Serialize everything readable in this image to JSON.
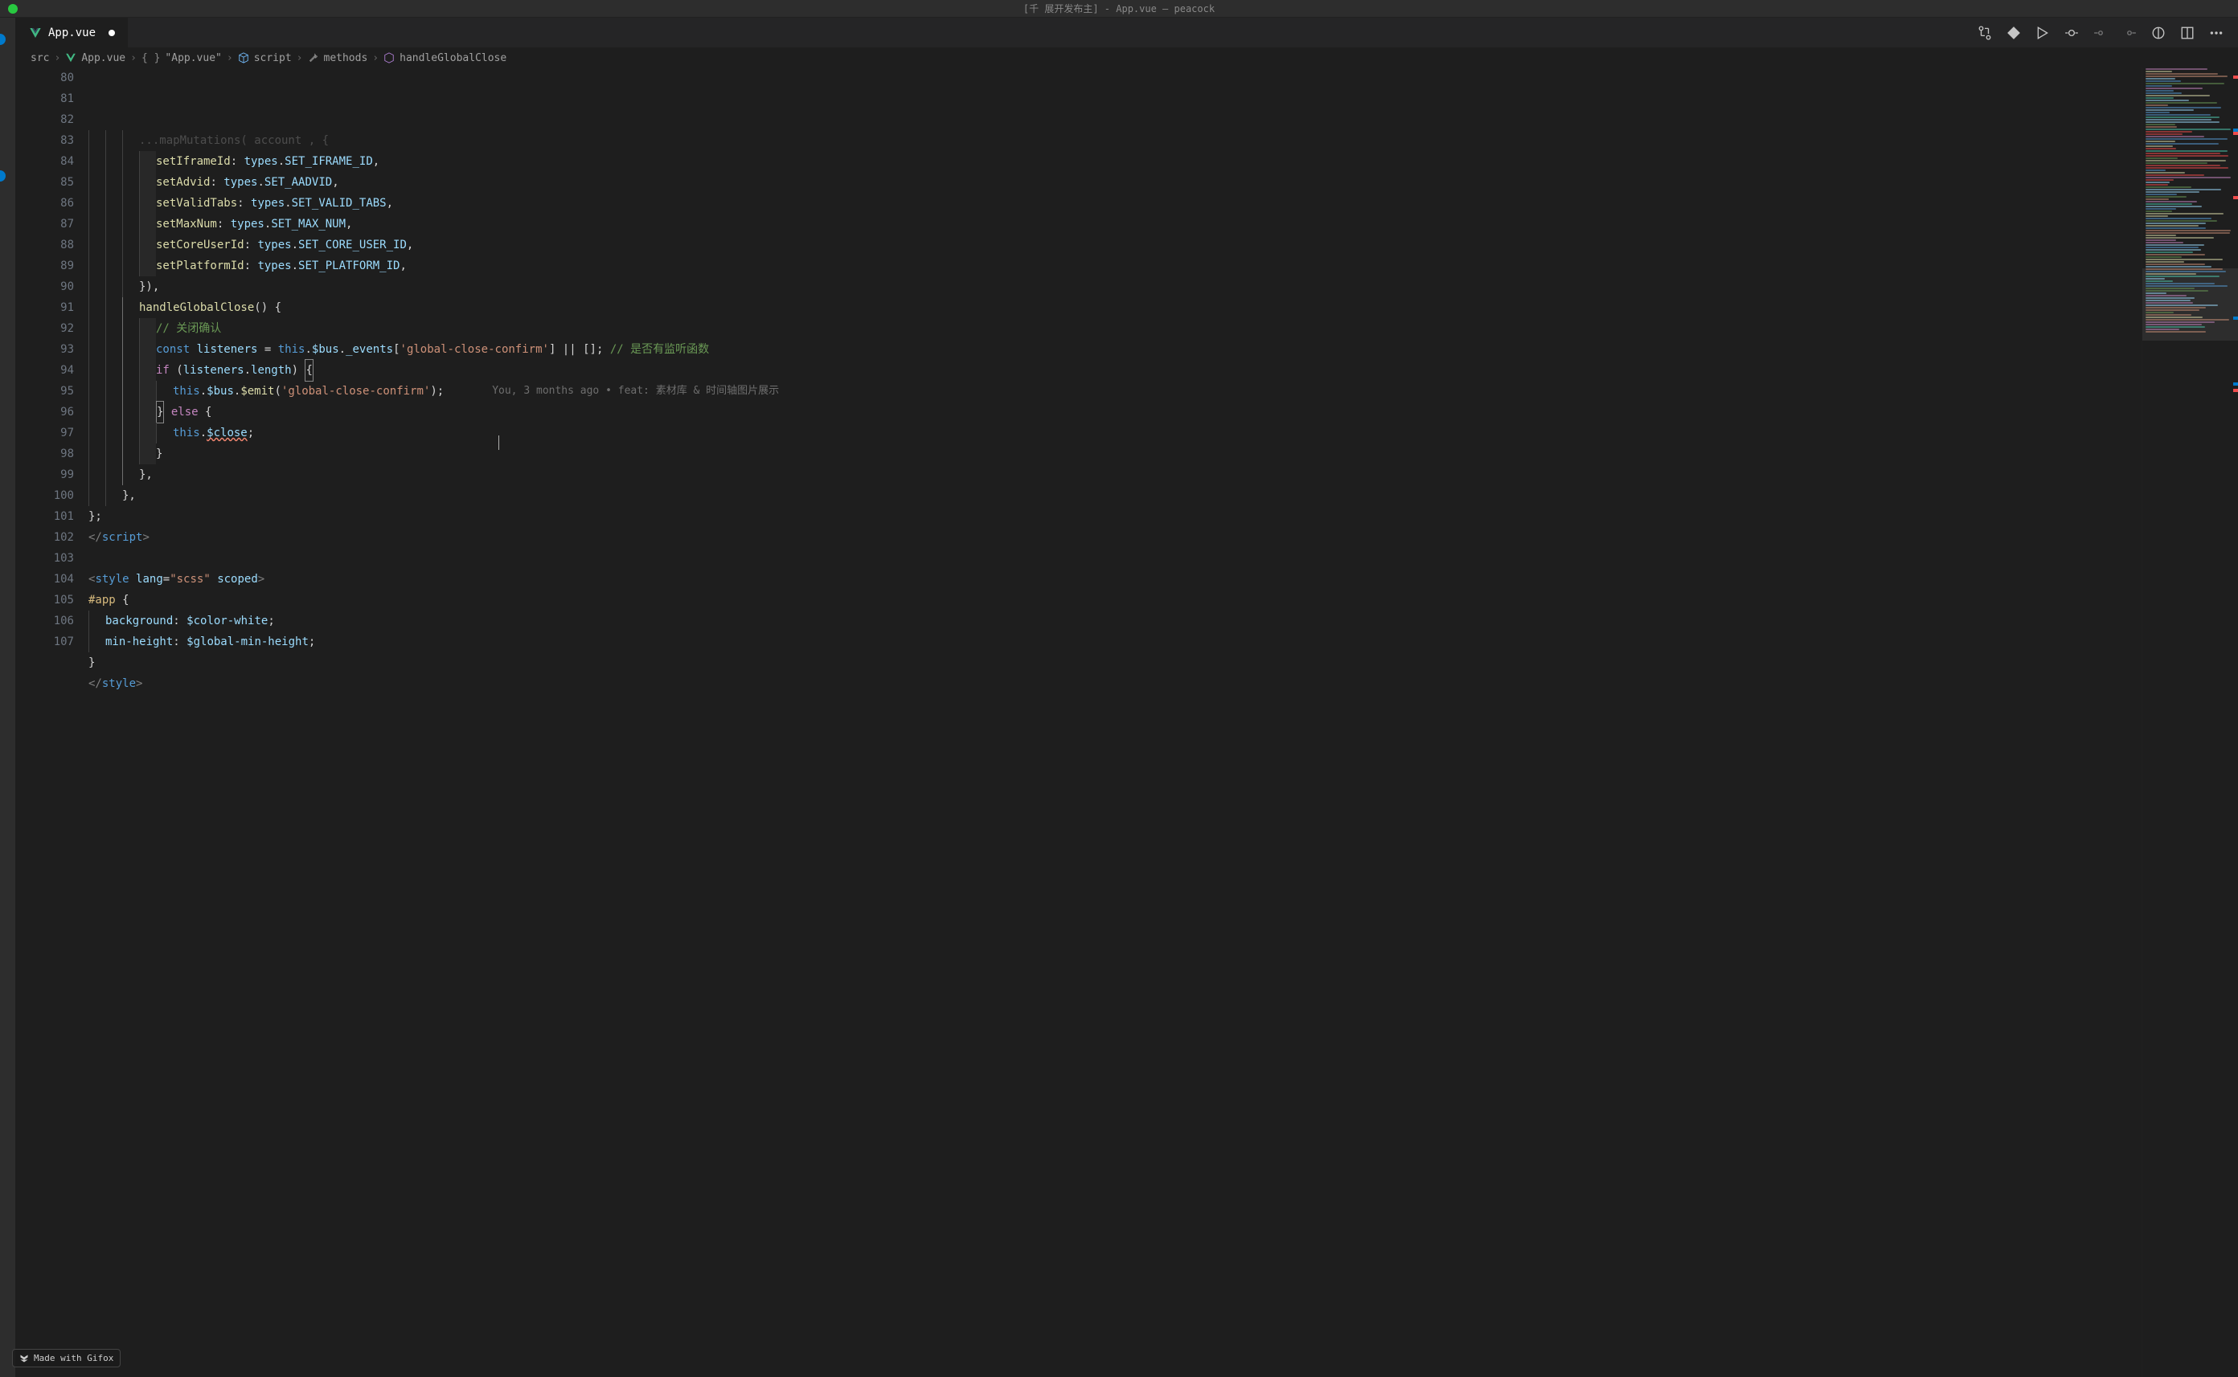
{
  "titlebar": {
    "text": "[千 展开发布主] - App.vue — peacock"
  },
  "tab": {
    "filename": "App.vue"
  },
  "breadcrumb": {
    "parts": [
      "src",
      "App.vue",
      "\"App.vue\"",
      "script",
      "methods",
      "handleGlobalClose"
    ]
  },
  "gutter": {
    "start": 80,
    "end": 107
  },
  "code": {
    "lines": [
      {
        "n": 80,
        "indent": 3,
        "tokens": [
          {
            "t": "...mapMutations( account , {",
            "c": "tok-punct",
            "faded": true
          }
        ]
      },
      {
        "n": 81,
        "indent": 4,
        "tokens": [
          {
            "t": "setIframeId",
            "c": "tok-func"
          },
          {
            "t": ": ",
            "c": "tok-punct"
          },
          {
            "t": "types",
            "c": "tok-prop"
          },
          {
            "t": ".",
            "c": "tok-punct"
          },
          {
            "t": "SET_IFRAME_ID",
            "c": "tok-prop"
          },
          {
            "t": ",",
            "c": "tok-punct"
          }
        ]
      },
      {
        "n": 82,
        "indent": 4,
        "tokens": [
          {
            "t": "setAdvid",
            "c": "tok-func"
          },
          {
            "t": ": ",
            "c": "tok-punct"
          },
          {
            "t": "types",
            "c": "tok-prop"
          },
          {
            "t": ".",
            "c": "tok-punct"
          },
          {
            "t": "SET_AADVID",
            "c": "tok-prop"
          },
          {
            "t": ",",
            "c": "tok-punct"
          }
        ]
      },
      {
        "n": 83,
        "indent": 4,
        "tokens": [
          {
            "t": "setValidTabs",
            "c": "tok-func"
          },
          {
            "t": ": ",
            "c": "tok-punct"
          },
          {
            "t": "types",
            "c": "tok-prop"
          },
          {
            "t": ".",
            "c": "tok-punct"
          },
          {
            "t": "SET_VALID_TABS",
            "c": "tok-prop"
          },
          {
            "t": ",",
            "c": "tok-punct"
          }
        ]
      },
      {
        "n": 84,
        "indent": 4,
        "tokens": [
          {
            "t": "setMaxNum",
            "c": "tok-func"
          },
          {
            "t": ": ",
            "c": "tok-punct"
          },
          {
            "t": "types",
            "c": "tok-prop"
          },
          {
            "t": ".",
            "c": "tok-punct"
          },
          {
            "t": "SET_MAX_NUM",
            "c": "tok-prop"
          },
          {
            "t": ",",
            "c": "tok-punct"
          }
        ]
      },
      {
        "n": 85,
        "indent": 4,
        "tokens": [
          {
            "t": "setCoreUserId",
            "c": "tok-func"
          },
          {
            "t": ": ",
            "c": "tok-punct"
          },
          {
            "t": "types",
            "c": "tok-prop"
          },
          {
            "t": ".",
            "c": "tok-punct"
          },
          {
            "t": "SET_CORE_USER_ID",
            "c": "tok-prop"
          },
          {
            "t": ",",
            "c": "tok-punct"
          }
        ]
      },
      {
        "n": 86,
        "indent": 4,
        "tokens": [
          {
            "t": "setPlatformId",
            "c": "tok-func"
          },
          {
            "t": ": ",
            "c": "tok-punct"
          },
          {
            "t": "types",
            "c": "tok-prop"
          },
          {
            "t": ".",
            "c": "tok-punct"
          },
          {
            "t": "SET_PLATFORM_ID",
            "c": "tok-prop"
          },
          {
            "t": ",",
            "c": "tok-punct"
          }
        ]
      },
      {
        "n": 87,
        "indent": 3,
        "tokens": [
          {
            "t": "}),",
            "c": "tok-punct"
          }
        ]
      },
      {
        "n": 88,
        "indent": 3,
        "tokens": [
          {
            "t": "handleGlobalClose",
            "c": "tok-func"
          },
          {
            "t": "() {",
            "c": "tok-punct"
          }
        ]
      },
      {
        "n": 89,
        "indent": 4,
        "tokens": [
          {
            "t": "// 关闭确认",
            "c": "tok-comment"
          }
        ]
      },
      {
        "n": 90,
        "indent": 4,
        "tokens": [
          {
            "t": "const",
            "c": "tok-this"
          },
          {
            "t": " ",
            "c": ""
          },
          {
            "t": "listeners",
            "c": "tok-prop"
          },
          {
            "t": " = ",
            "c": "tok-punct"
          },
          {
            "t": "this",
            "c": "tok-this"
          },
          {
            "t": ".",
            "c": "tok-punct"
          },
          {
            "t": "$bus",
            "c": "tok-prop"
          },
          {
            "t": ".",
            "c": "tok-punct"
          },
          {
            "t": "_events",
            "c": "tok-prop"
          },
          {
            "t": "[",
            "c": "tok-punct"
          },
          {
            "t": "'global-close-confirm'",
            "c": "tok-string"
          },
          {
            "t": "] || []; ",
            "c": "tok-punct"
          },
          {
            "t": "// 是否有监听函数",
            "c": "tok-comment"
          }
        ]
      },
      {
        "n": 91,
        "indent": 4,
        "tokens": [
          {
            "t": "if",
            "c": "tok-keyword"
          },
          {
            "t": " (",
            "c": "tok-punct"
          },
          {
            "t": "listeners",
            "c": "tok-prop"
          },
          {
            "t": ".",
            "c": "tok-punct"
          },
          {
            "t": "length",
            "c": "tok-prop"
          },
          {
            "t": ") ",
            "c": "tok-punct"
          },
          {
            "t": "{",
            "c": "tok-punct highlight-bracket"
          }
        ]
      },
      {
        "n": 92,
        "indent": 5,
        "tokens": [
          {
            "t": "this",
            "c": "tok-this"
          },
          {
            "t": ".",
            "c": "tok-punct"
          },
          {
            "t": "$bus",
            "c": "tok-prop"
          },
          {
            "t": ".",
            "c": "tok-punct"
          },
          {
            "t": "$emit",
            "c": "tok-func"
          },
          {
            "t": "(",
            "c": "tok-punct"
          },
          {
            "t": "'global-close-confirm'",
            "c": "tok-string"
          },
          {
            "t": ");",
            "c": "tok-punct"
          }
        ],
        "blame": "You, 3 months ago • feat: 素材库 & 时间轴图片展示"
      },
      {
        "n": 93,
        "indent": 4,
        "tokens": [
          {
            "t": "}",
            "c": "tok-punct highlight-bracket"
          },
          {
            "t": " ",
            "c": ""
          },
          {
            "t": "else",
            "c": "tok-keyword"
          },
          {
            "t": " {",
            "c": "tok-punct"
          }
        ]
      },
      {
        "n": 94,
        "indent": 5,
        "tokens": [
          {
            "t": "this",
            "c": "tok-this"
          },
          {
            "t": ".",
            "c": "tok-punct"
          },
          {
            "t": "$close",
            "c": "tok-prop squiggle"
          },
          {
            "t": ";",
            "c": "tok-punct"
          }
        ]
      },
      {
        "n": 95,
        "indent": 4,
        "tokens": [
          {
            "t": "}",
            "c": "tok-punct"
          }
        ]
      },
      {
        "n": 96,
        "indent": 3,
        "tokens": [
          {
            "t": "},",
            "c": "tok-punct"
          }
        ]
      },
      {
        "n": 97,
        "indent": 2,
        "tokens": [
          {
            "t": "},",
            "c": "tok-punct"
          }
        ]
      },
      {
        "n": 98,
        "indent": 0,
        "tokens": [
          {
            "t": "};",
            "c": "tok-punct"
          }
        ]
      },
      {
        "n": 99,
        "indent": 0,
        "tokens": [
          {
            "t": "</",
            "c": "tok-tag"
          },
          {
            "t": "script",
            "c": "tok-tagname"
          },
          {
            "t": ">",
            "c": "tok-tag"
          }
        ]
      },
      {
        "n": 100,
        "indent": 0,
        "tokens": []
      },
      {
        "n": 101,
        "indent": 0,
        "tokens": [
          {
            "t": "<",
            "c": "tok-tag"
          },
          {
            "t": "style",
            "c": "tok-tagname"
          },
          {
            "t": " ",
            "c": ""
          },
          {
            "t": "lang",
            "c": "tok-attr"
          },
          {
            "t": "=",
            "c": "tok-punct"
          },
          {
            "t": "\"scss\"",
            "c": "tok-string"
          },
          {
            "t": " ",
            "c": ""
          },
          {
            "t": "scoped",
            "c": "tok-attr"
          },
          {
            "t": ">",
            "c": "tok-tag"
          }
        ]
      },
      {
        "n": 102,
        "indent": 0,
        "tokens": [
          {
            "t": "#app",
            "c": "tok-sel"
          },
          {
            "t": " {",
            "c": "tok-punct"
          }
        ]
      },
      {
        "n": 103,
        "indent": 1,
        "tokens": [
          {
            "t": "background",
            "c": "tok-cssslot"
          },
          {
            "t": ": ",
            "c": "tok-punct"
          },
          {
            "t": "$color-white",
            "c": "tok-prop"
          },
          {
            "t": ";",
            "c": "tok-punct"
          }
        ]
      },
      {
        "n": 104,
        "indent": 1,
        "tokens": [
          {
            "t": "min-height",
            "c": "tok-cssslot"
          },
          {
            "t": ": ",
            "c": "tok-punct"
          },
          {
            "t": "$global-min-height",
            "c": "tok-prop"
          },
          {
            "t": ";",
            "c": "tok-punct"
          }
        ]
      },
      {
        "n": 105,
        "indent": 0,
        "tokens": [
          {
            "t": "}",
            "c": "tok-punct"
          }
        ]
      },
      {
        "n": 106,
        "indent": 0,
        "tokens": [
          {
            "t": "</",
            "c": "tok-tag"
          },
          {
            "t": "style",
            "c": "tok-tagname"
          },
          {
            "t": ">",
            "c": "tok-tag"
          }
        ]
      },
      {
        "n": 107,
        "indent": 0,
        "tokens": []
      }
    ]
  },
  "watermark": {
    "text": "Made with Gifox"
  }
}
